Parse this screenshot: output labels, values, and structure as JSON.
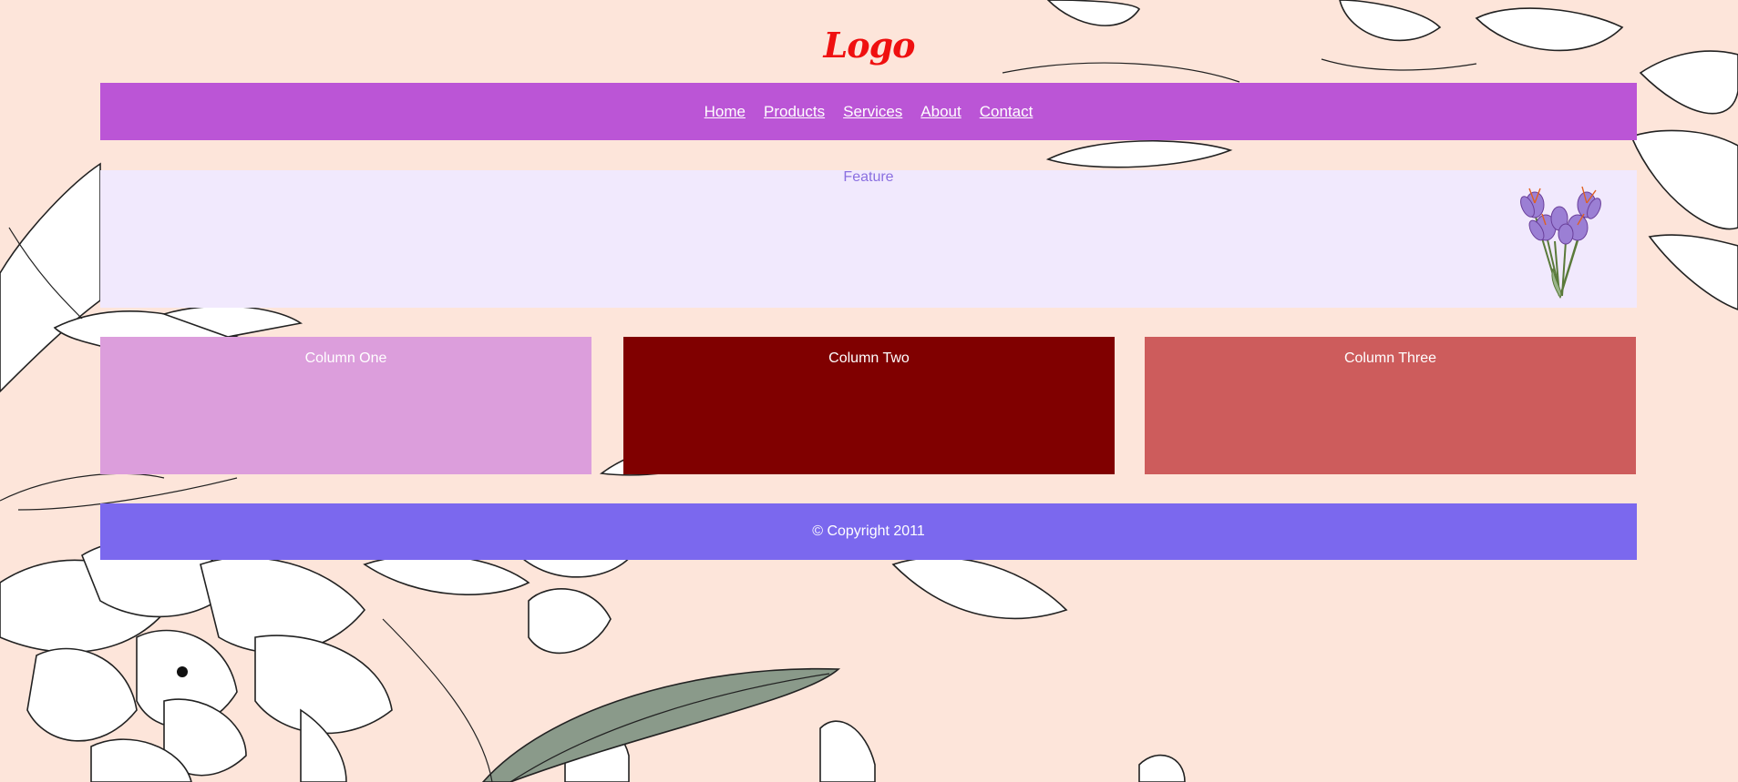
{
  "logo": {
    "text": "Logo"
  },
  "nav": {
    "items": [
      {
        "label": "Home"
      },
      {
        "label": "Products"
      },
      {
        "label": "Services"
      },
      {
        "label": "About"
      },
      {
        "label": "Contact"
      }
    ]
  },
  "feature": {
    "title": "Feature",
    "image": "crocus-flowers-bouquet"
  },
  "columns": [
    {
      "label": "Column One",
      "color": "#dda0dd"
    },
    {
      "label": "Column Two",
      "color": "#800000"
    },
    {
      "label": "Column Three",
      "color": "#cd5c5c"
    }
  ],
  "footer": {
    "text": "© Copyright 2011"
  },
  "colors": {
    "background": "#fde5da",
    "nav": "#bb55d6",
    "feature_bg": "#f1e9fd",
    "footer": "#7b68ee",
    "logo": "#ef1010"
  }
}
